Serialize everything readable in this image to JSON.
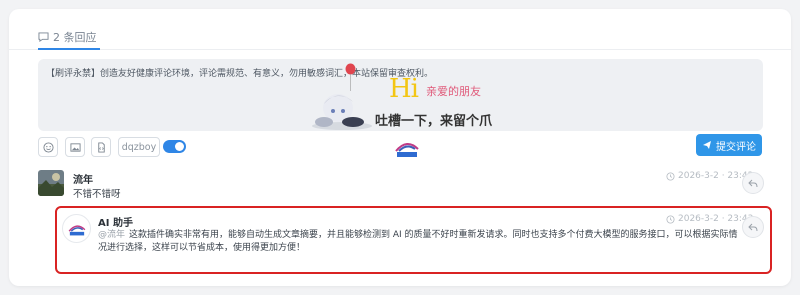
{
  "tabs": {
    "comment_count_label": "2 条回应"
  },
  "editor": {
    "notice": "【刷评永禁】创造友好健康评论环境，评论需规范、有意义，勿用敏感词汇，本站保留审查权利。",
    "banner_hi": "Hi",
    "banner_greeting": "亲爱的朋友",
    "banner_prompt": "吐槽一下，来留个爪"
  },
  "toolbar": {
    "nickname": "dqzboy",
    "toggle_on": true,
    "submit_label": "提交评论",
    "icons": [
      "smile-icon",
      "image-icon",
      "file-code-icon"
    ]
  },
  "comments": [
    {
      "user": "流年",
      "text": "不错不错呀",
      "time": "2026-3-2 · 23:42"
    },
    {
      "user": "AI 助手",
      "mention": "@流年",
      "text": "这款插件确实非常有用，能够自动生成文章摘要，并且能够检测到 AI 的质量不好时重新发请求。同时也支持多个付费大模型的服务接口，可以根据实际情况进行选择，这样可以节省成本，使用得更加方便！",
      "time": "2026-3-2 · 23:43"
    }
  ],
  "colors": {
    "accent": "#2f86e6",
    "highlight": "#d92323",
    "submit_bg": "#2f96e8"
  }
}
